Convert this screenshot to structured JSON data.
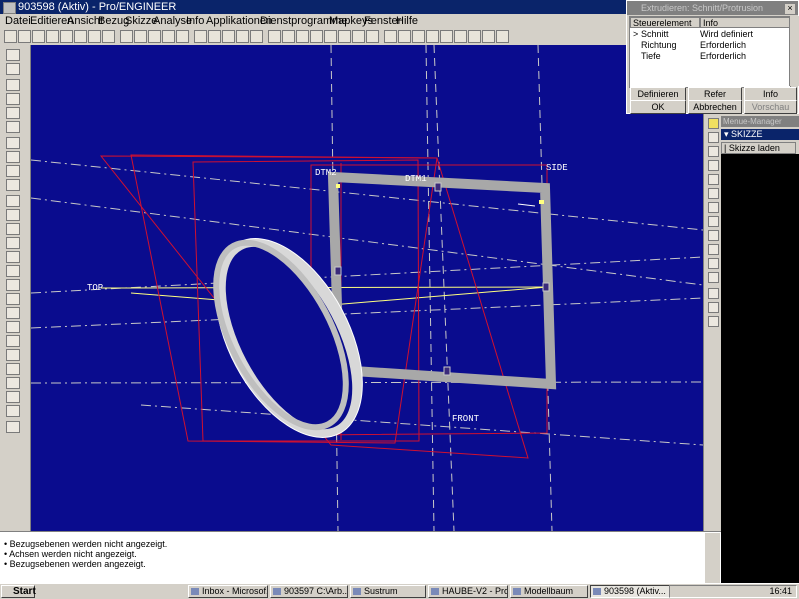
{
  "window": {
    "title": "903598 (Aktiv) - Pro/ENGINEER"
  },
  "menu": [
    "Datei",
    "Editieren",
    "Ansicht",
    "Bezug",
    "Skizze",
    "Analyse",
    "Info",
    "Applikationen",
    "Dienstprogramme",
    "Mapkeys",
    "Fenster",
    "Hilfe"
  ],
  "dialog": {
    "title": "Extrudieren: Schnitt/Protrusion",
    "col_element": "Steuerelement",
    "col_info": "Info",
    "rows": [
      {
        "marker": ">",
        "element": "Schnitt",
        "info": "Wird definiert"
      },
      {
        "marker": "",
        "element": "Richtung",
        "info": "Erforderlich"
      },
      {
        "marker": "",
        "element": "Tiefe",
        "info": "Erforderlich"
      }
    ],
    "buttons": {
      "definieren": "Definieren",
      "refer": "Refer",
      "info": "Info",
      "ok": "OK",
      "abbrechen": "Abbrechen",
      "vorschau": "Vorschau"
    }
  },
  "menu_manager": {
    "title": "Menue-Manager",
    "selected": "SKIZZE",
    "item": "Skizze laden"
  },
  "viewport": {
    "labels": {
      "dtm2": "DTM2",
      "dtm1": "DTM1",
      "side": "SIDE",
      "top": "TOP",
      "front": "FRONT"
    },
    "colors": {
      "background": "#0a0c8e",
      "datum_plane": "#d01030",
      "sketch_frame": "#a8a8a8",
      "axis": "#ffff80"
    }
  },
  "messages": [
    "Bezugsebenen werden nicht angezeigt.",
    "Achsen werden nicht angezeigt.",
    "Bezugsebenen werden angezeigt."
  ],
  "taskbar": {
    "start": "Start",
    "tasks": [
      "Inbox - Microsof...",
      "903597  C:\\Arb...",
      "Sustrum",
      "HAUBE-V2 - Pro...",
      "Modellbaum",
      "903598 (Aktiv..."
    ],
    "clock": "16:41"
  }
}
